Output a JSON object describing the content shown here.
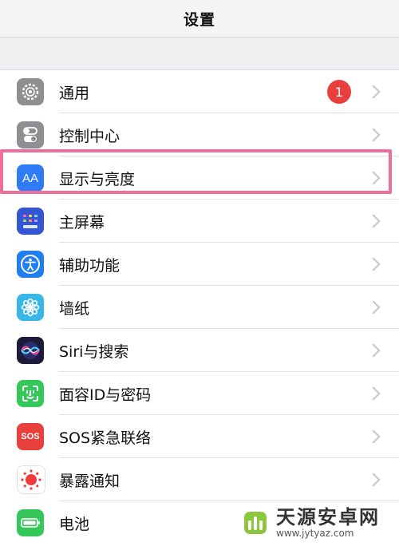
{
  "header": {
    "title": "设置"
  },
  "settings": {
    "items": [
      {
        "label": "通用",
        "icon": "gear-icon",
        "color": "#8e8e93",
        "badge": "1"
      },
      {
        "label": "控制中心",
        "icon": "toggles-icon",
        "color": "#8e8e93"
      },
      {
        "label": "显示与亮度",
        "icon": "text-size-icon",
        "icon_text": "AA",
        "color": "#2f7cf6"
      },
      {
        "label": "主屏幕",
        "icon": "home-grid-icon",
        "color": "#3556d4"
      },
      {
        "label": "辅助功能",
        "icon": "accessibility-icon",
        "color": "#1f7ef0"
      },
      {
        "label": "墙纸",
        "icon": "flower-icon",
        "color": "#38b6e6"
      },
      {
        "label": "Siri与搜索",
        "icon": "siri-icon",
        "color": "#1c1c3a"
      },
      {
        "label": "面容ID与密码",
        "icon": "face-id-icon",
        "color": "#34c759"
      },
      {
        "label": "SOS紧急联络",
        "icon": "sos-icon",
        "icon_text": "SOS",
        "color": "#e8403c"
      },
      {
        "label": "暴露通知",
        "icon": "exposure-icon",
        "color": "#ffffff"
      },
      {
        "label": "电池",
        "icon": "battery-icon",
        "color": "#34c759"
      }
    ]
  },
  "watermark": {
    "name": "天源安卓网",
    "url": "www.jytyaz.com"
  },
  "colors": {
    "highlight": "#ef6e98",
    "badge": "#e8403c",
    "chevron": "#c4c4c8"
  }
}
